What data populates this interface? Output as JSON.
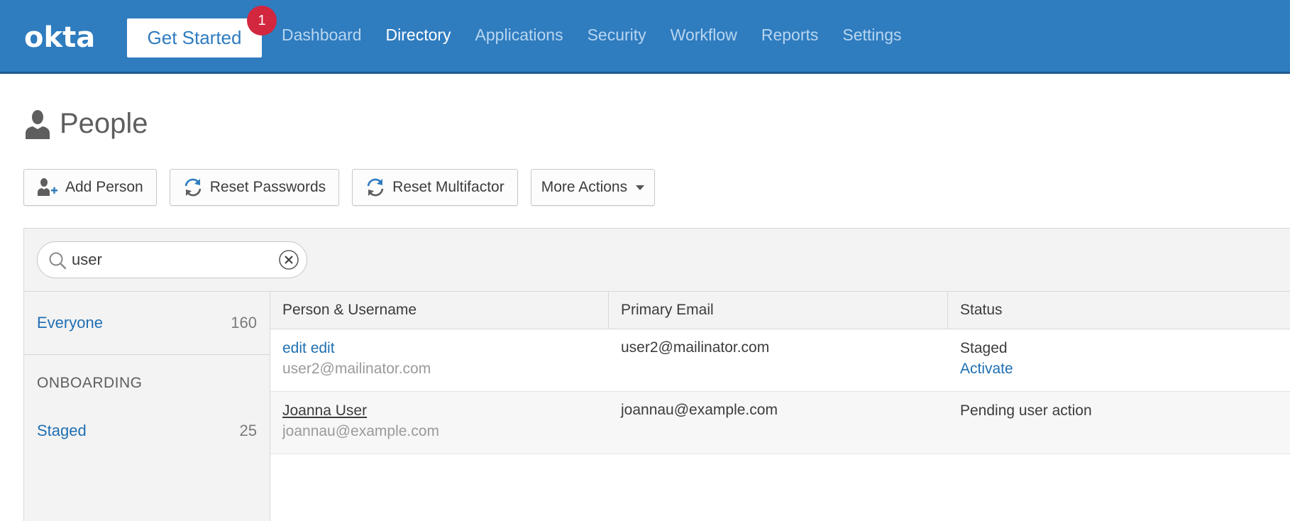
{
  "header": {
    "logo_text": "okta",
    "get_started_label": "Get Started",
    "notification_count": "1",
    "nav": [
      {
        "label": "Dashboard",
        "active": false
      },
      {
        "label": "Directory",
        "active": true
      },
      {
        "label": "Applications",
        "active": false
      },
      {
        "label": "Security",
        "active": false
      },
      {
        "label": "Workflow",
        "active": false
      },
      {
        "label": "Reports",
        "active": false
      },
      {
        "label": "Settings",
        "active": false
      }
    ]
  },
  "page": {
    "title": "People",
    "icon": "person-icon"
  },
  "actions": {
    "add_person": "Add Person",
    "reset_passwords": "Reset Passwords",
    "reset_multifactor": "Reset Multifactor",
    "more_actions": "More Actions"
  },
  "search": {
    "value": "user",
    "placeholder": ""
  },
  "sidebar": {
    "everyone": {
      "label": "Everyone",
      "count": "160"
    },
    "section_heading": "ONBOARDING",
    "staged": {
      "label": "Staged",
      "count": "25"
    }
  },
  "table": {
    "columns": [
      "Person & Username",
      "Primary Email",
      "Status"
    ],
    "rows": [
      {
        "name": "edit edit",
        "username": "user2@mailinator.com",
        "email": "user2@mailinator.com",
        "status": "Staged",
        "action": "Activate"
      },
      {
        "name": "Joanna User",
        "username": "joannau@example.com",
        "email": "joannau@example.com",
        "status": "Pending user action",
        "action": ""
      }
    ]
  },
  "colors": {
    "brand": "#2f7cbf",
    "link": "#1f6fb2",
    "badge": "#d3263f"
  }
}
